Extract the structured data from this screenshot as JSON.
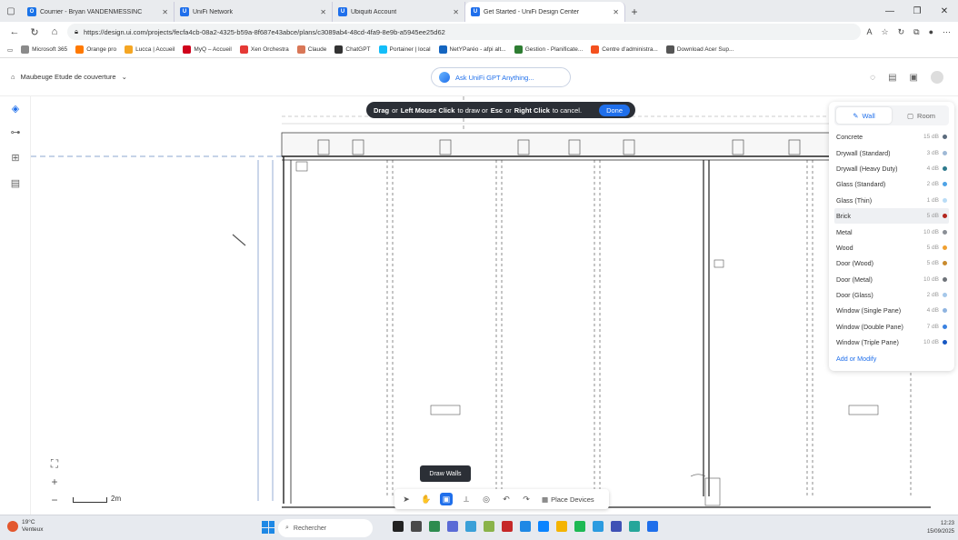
{
  "browser": {
    "tabs": [
      {
        "label": "Courrier - Bryan VANDENMESSINC",
        "color": "#1a73e8",
        "glyph": "O"
      },
      {
        "label": "UniFi Network",
        "color": "#1f6feb",
        "glyph": "U"
      },
      {
        "label": "Ubiquiti Account",
        "color": "#1f6feb",
        "glyph": "U"
      },
      {
        "label": "Get Started - UniFi Design Center",
        "color": "#1f6feb",
        "glyph": "U",
        "active": true
      }
    ],
    "url": "https://design.ui.com/projects/fecfa4cb-08a2-4325-b59a-8f687e43abce/plans/c3089ab4-48cd-4fa9-8e9b-a5945ee25d62",
    "favorites": [
      {
        "label": "Microsoft 365",
        "color": "#8a8a8a"
      },
      {
        "label": "Orange pro",
        "color": "#ff7900"
      },
      {
        "label": "Lucca | Accueil",
        "color": "#f5a623"
      },
      {
        "label": "MyQ – Accueil",
        "color": "#d0021b"
      },
      {
        "label": "Xen Orchestra",
        "color": "#e53935"
      },
      {
        "label": "Claude",
        "color": "#d97757"
      },
      {
        "label": "ChatGPT",
        "color": "#333333"
      },
      {
        "label": "Portainer | local",
        "color": "#13bef9"
      },
      {
        "label": "NetYParéo - afpi alt...",
        "color": "#1565c0"
      },
      {
        "label": "Gestion - Planificate...",
        "color": "#2e7d32"
      },
      {
        "label": "Centre d'administra...",
        "color": "#f4511e"
      },
      {
        "label": "Download Acer Sup...",
        "color": "#555555"
      }
    ]
  },
  "app": {
    "project_name": "Maubeuge Etude de couverture",
    "gpt_label": "Ask UniFi GPT Anything...",
    "banner": {
      "part1": "Drag",
      "part2": " or ",
      "part3": "Left Mouse Click",
      "part4": " to draw or ",
      "part5": "Esc",
      "part6": " or ",
      "part7": "Right Click",
      "part8": " to cancel.",
      "done": "Done"
    },
    "panel": {
      "tab_wall": "Wall",
      "tab_room": "Room",
      "materials": [
        {
          "name": "Concrete",
          "db": "15 dB",
          "color": "#5b6b7d"
        },
        {
          "name": "Drywall (Standard)",
          "db": "3 dB",
          "color": "#9fb9d6"
        },
        {
          "name": "Drywall (Heavy Duty)",
          "db": "4 dB",
          "color": "#2d7a8c"
        },
        {
          "name": "Glass (Standard)",
          "db": "2 dB",
          "color": "#4ea3e6"
        },
        {
          "name": "Glass (Thin)",
          "db": "1 dB",
          "color": "#b9dcf6"
        },
        {
          "name": "Brick",
          "db": "5 dB",
          "color": "#b3261e",
          "selected": true
        },
        {
          "name": "Metal",
          "db": "10 dB",
          "color": "#8a8f96"
        },
        {
          "name": "Wood",
          "db": "5 dB",
          "color": "#f0a030"
        },
        {
          "name": "Door (Wood)",
          "db": "5 dB",
          "color": "#c98b2e"
        },
        {
          "name": "Door (Metal)",
          "db": "10 dB",
          "color": "#6e7379"
        },
        {
          "name": "Door (Glass)",
          "db": "2 dB",
          "color": "#a6c8ea"
        },
        {
          "name": "Window (Single Pane)",
          "db": "4 dB",
          "color": "#8fb4e0"
        },
        {
          "name": "Window (Double Pane)",
          "db": "7 dB",
          "color": "#3b82e0"
        },
        {
          "name": "Window (Triple Pane)",
          "db": "10 dB",
          "color": "#1757c2"
        }
      ],
      "add_modify": "Add or Modify"
    },
    "tooltip": "Draw Walls",
    "place_devices": "Place Devices",
    "scale_label": "2m"
  },
  "taskbar": {
    "temperature": "19°C",
    "weather_desc": "Venteux",
    "search_placeholder": "Rechercher",
    "time": "12:23",
    "date": "15/09/2025"
  }
}
